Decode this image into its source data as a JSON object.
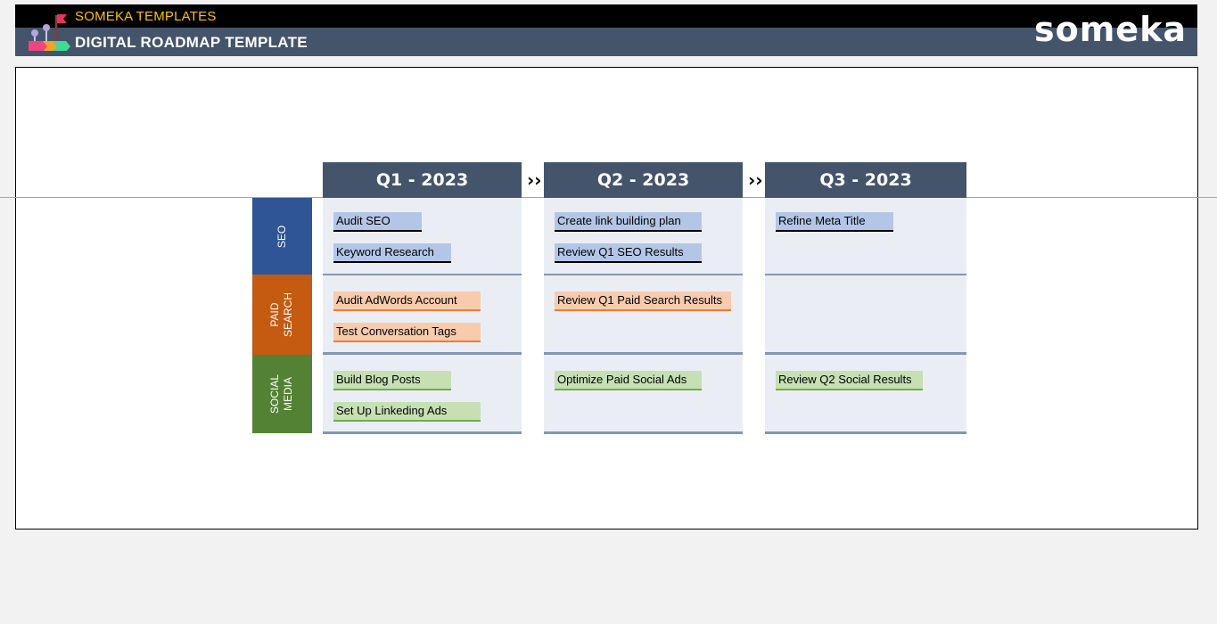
{
  "header": {
    "subtitle": "SOMEKA TEMPLATES",
    "title": "DIGITAL ROADMAP TEMPLATE",
    "logo_text": "someka",
    "colors": {
      "subtitle": "#ffc000",
      "bar": "#44546a"
    }
  },
  "roadmap": {
    "quarters": [
      {
        "label": "Q1 - 2023"
      },
      {
        "label": "Q2 - 2023"
      },
      {
        "label": "Q3 - 2023"
      }
    ],
    "arrow_glyph": "››",
    "categories": [
      {
        "label": "SEO",
        "color": "#2f5597"
      },
      {
        "label": "PAID\nSEARCH",
        "color": "#c55a11"
      },
      {
        "label": "SOCIAL\nMEDIA",
        "color": "#548235"
      }
    ],
    "tasks": {
      "seo": [
        [
          "Audit SEO",
          "Keyword Research"
        ],
        [
          "Create link building plan",
          "Review Q1 SEO  Results"
        ],
        [
          "Refine Meta Title"
        ]
      ],
      "paid": [
        [
          "Audit AdWords Account",
          "Test Conversation Tags"
        ],
        [
          "Review Q1 Paid Search  Results"
        ],
        []
      ],
      "social": [
        [
          "Build Blog Posts",
          "Set Up Linkeding Ads"
        ],
        [
          "Optimize Paid Social Ads"
        ],
        [
          "Review Q2 Social Results"
        ]
      ]
    }
  }
}
